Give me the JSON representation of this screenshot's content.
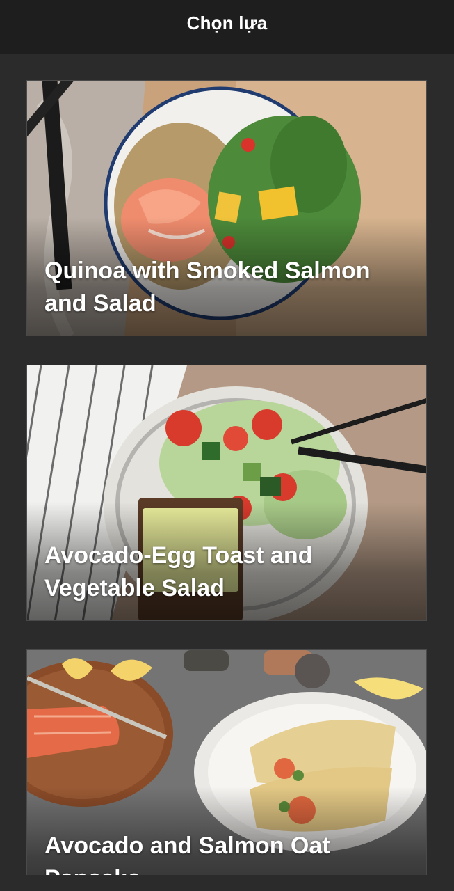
{
  "header": {
    "title": "Chọn lựa"
  },
  "recipes": [
    {
      "title": "Quinoa with Smoked Salmon and Salad"
    },
    {
      "title": "Avocado-Egg Toast and Vegetable Salad"
    },
    {
      "title": "Avocado and Salmon Oat Pancake"
    }
  ],
  "colors": {
    "header_bg": "#1e1e1e",
    "page_bg": "#2b2b2b",
    "text": "#ffffff"
  }
}
